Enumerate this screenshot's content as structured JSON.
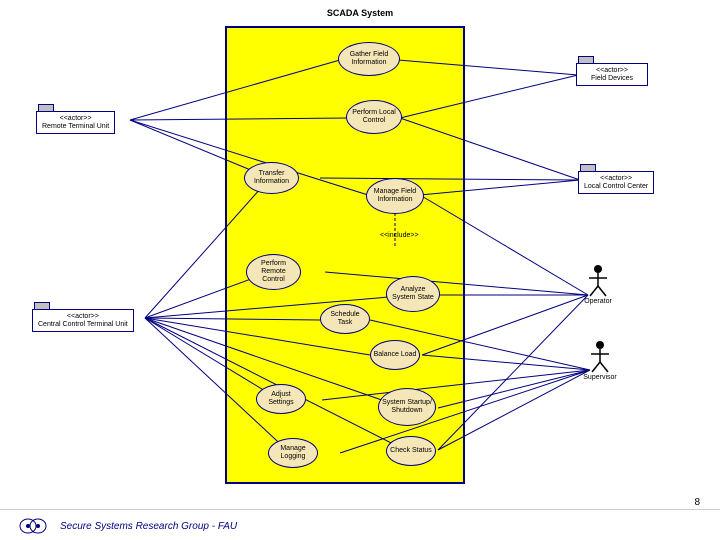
{
  "title": "SCADA System",
  "usecases": {
    "gather": "Gather Field\nInformation",
    "local": "Perform\nLocal\nControl",
    "transfer": "Transfer\nInformation",
    "manage_field": "Manage\nField\nInformation",
    "remote": "Perform\nRemote\nControl",
    "analyze": "Analyze\nSystem\nState",
    "schedule": "Schedule\nTask",
    "balance": "Balance\nLoad",
    "adjust": "Adjust\nSettings",
    "startup": "System\nStartup/\nShutdown",
    "logging": "Manage\nLogging",
    "check": "Check\nStatus"
  },
  "actors": {
    "rtu": {
      "stereo": "<<actor>>",
      "name": "Remote Terminal Unit"
    },
    "cctu": {
      "stereo": "<<actor>>",
      "name": "Central Control Terminal Unit"
    },
    "field_dev": {
      "stereo": "<<actor>>",
      "name": "Field Devices"
    },
    "lcc": {
      "stereo": "<<actor>>",
      "name": "Local Control Center"
    },
    "operator": "Operator",
    "supervisor": "Supervisor"
  },
  "include_label": "<<include>>",
  "footer": "Secure Systems Research Group - FAU",
  "page": "8"
}
